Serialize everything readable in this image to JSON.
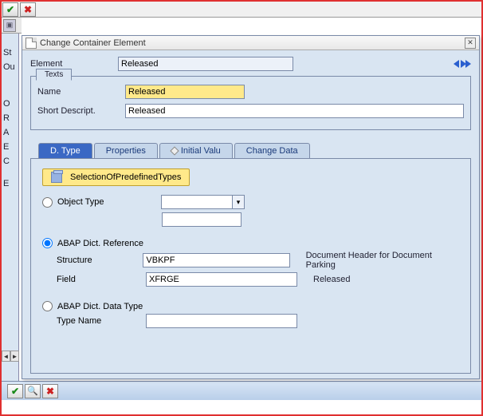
{
  "dialog": {
    "title": "Change Container Element",
    "element_label": "Element",
    "element_value": "Released"
  },
  "texts": {
    "group_label": "Texts",
    "name_label": "Name",
    "name_value": "Released",
    "short_label": "Short Descript.",
    "short_value": "Released"
  },
  "tabs": {
    "dtype": "D. Type",
    "properties": "Properties",
    "initial": "Initial Valu",
    "change": "Change Data"
  },
  "dtype": {
    "sel_btn": "SelectionOfPredefinedTypes",
    "object_type_label": "Object Type",
    "object_type_value": "",
    "abap_dict_ref_label": "ABAP Dict. Reference",
    "structure_label": "Structure",
    "structure_value": "VBKPF",
    "structure_desc": "Document Header for Document Parking",
    "field_label": "Field",
    "field_value": "XFRGE",
    "field_desc": "Released",
    "abap_data_type_label": "ABAP Dict. Data Type",
    "type_name_label": "Type Name",
    "type_name_value": ""
  },
  "left_stubs": {
    "st": "St",
    "ou": "Ou",
    "o": "O",
    "r": "R",
    "a": "A",
    "e1": "E",
    "c": "C",
    "e2": "E"
  }
}
